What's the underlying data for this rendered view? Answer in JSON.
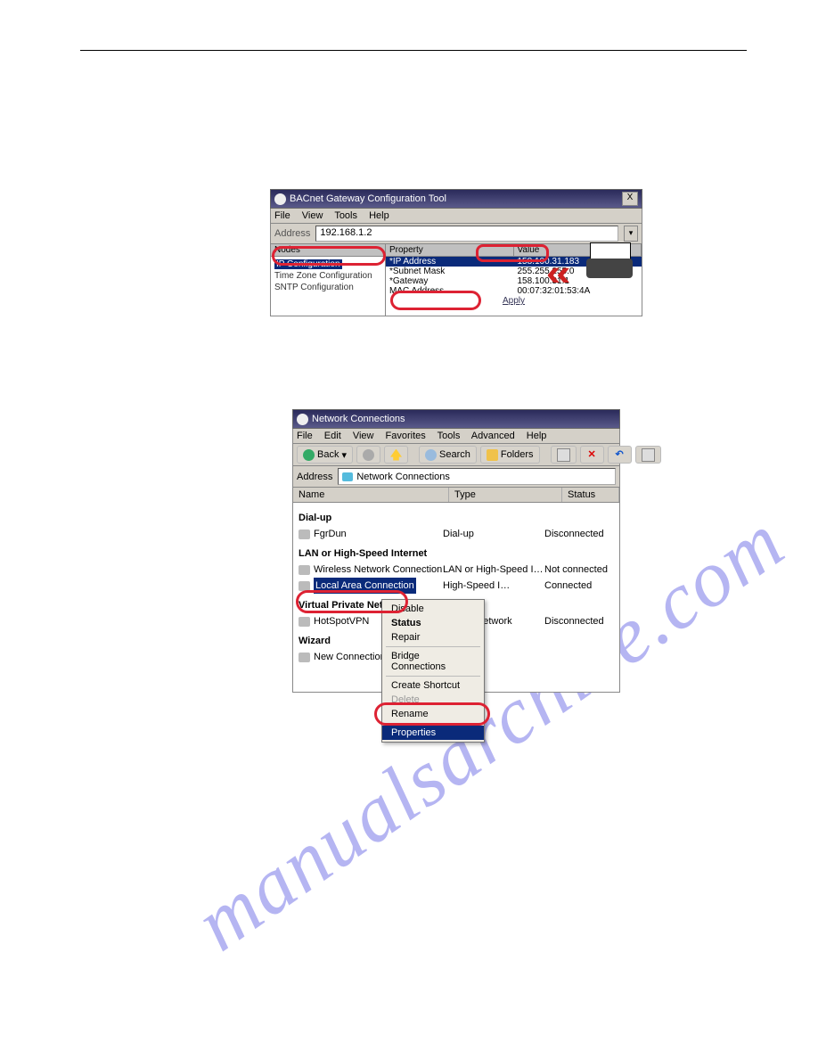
{
  "watermark": "manualsarchive.com",
  "win1": {
    "title": "BACnet Gateway Configuration Tool",
    "close": "X",
    "menu": [
      "File",
      "View",
      "Tools",
      "Help"
    ],
    "addr_label": "Address",
    "addr_value": "192.168.1.2",
    "nodes_hdr": "Nodes",
    "nodes": [
      "IP Configuration",
      "Time Zone Configuration",
      "SNTP Configuration"
    ],
    "prop_hdr": "Property",
    "val_hdr": "Value",
    "rows": [
      {
        "p": "*IP Address",
        "v": "158.100.31.183"
      },
      {
        "p": "*Subnet Mask",
        "v": "255.255.255.0"
      },
      {
        "p": "*Gateway",
        "v": "158.100.31.1"
      },
      {
        "p": "MAC Address",
        "v": "00:07:32:01:53:4A"
      }
    ],
    "apply": "Apply"
  },
  "win2": {
    "title": "Network Connections",
    "menu": [
      "File",
      "Edit",
      "View",
      "Favorites",
      "Tools",
      "Advanced",
      "Help"
    ],
    "toolbar": {
      "back": "Back",
      "search": "Search",
      "folders": "Folders"
    },
    "addr_label": "Address",
    "addr_value": "Network Connections",
    "cols": [
      "Name",
      "Type",
      "Status"
    ],
    "groups": [
      {
        "name": "Dial-up",
        "items": [
          {
            "n": "FgrDun",
            "t": "Dial-up",
            "s": "Disconnected"
          }
        ]
      },
      {
        "name": "LAN or High-Speed Internet",
        "items": [
          {
            "n": "Wireless Network Connection",
            "t": "LAN or High-Speed I…",
            "s": "Not connected"
          },
          {
            "n": "Local Area Connection",
            "t": "High-Speed I…",
            "s": "Connected",
            "sel": true
          }
        ]
      },
      {
        "name": "Virtual Private Network",
        "items": [
          {
            "n": "HotSpotVPN",
            "t": "Private Network",
            "s": "Disconnected"
          }
        ]
      },
      {
        "name": "Wizard",
        "items": [
          {
            "n": "New Connection Wizard",
            "t": "",
            "s": ""
          }
        ]
      }
    ],
    "ctx": {
      "items": [
        {
          "label": "Disable"
        },
        {
          "label": "Status",
          "bold": true
        },
        {
          "label": "Repair"
        },
        {
          "hr": true
        },
        {
          "label": "Bridge Connections"
        },
        {
          "hr": true
        },
        {
          "label": "Create Shortcut"
        },
        {
          "label": "Delete",
          "disabled": true
        },
        {
          "label": "Rename"
        },
        {
          "hr": true
        },
        {
          "label": "Properties",
          "sel": true
        }
      ]
    }
  }
}
